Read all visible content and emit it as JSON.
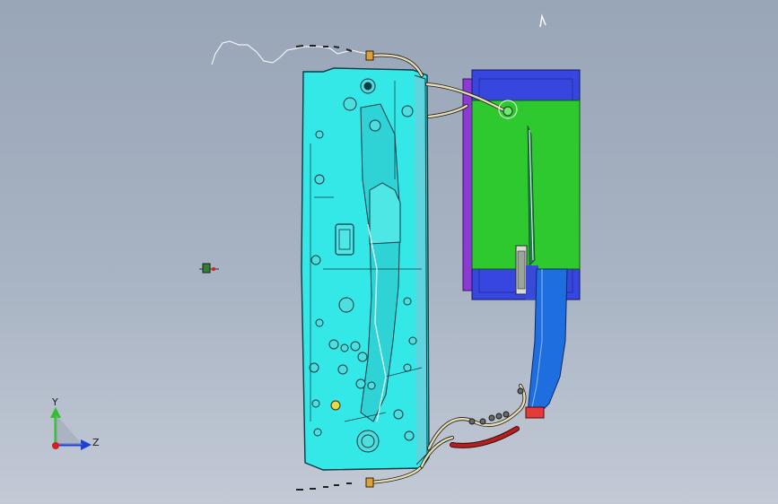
{
  "viewport": {
    "axis_triad": {
      "y_label": "Y",
      "z_label": "Z",
      "colors": {
        "y": "#2fbf2f",
        "z": "#1f3fd6",
        "x": "#d42020"
      }
    }
  },
  "colors": {
    "mold_plate": "#35e8e8",
    "mold_outline": "#0a3a44",
    "block_blue": "#3846e0",
    "block_purple": "#8b3ad6",
    "block_green": "#2ec92e",
    "part_blue": "#1e6ee0",
    "hose": "#e7dcb0",
    "hose_red": "#b32020"
  },
  "icons": [
    "triad-icon",
    "cursor-marker-icon"
  ]
}
